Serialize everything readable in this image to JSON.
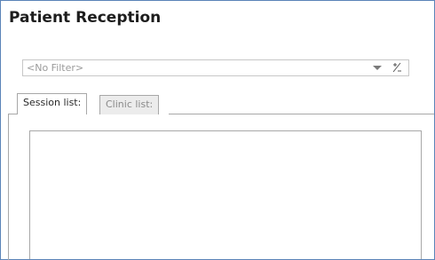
{
  "header": {
    "title": "Patient Reception"
  },
  "filter": {
    "value": "<No Filter>",
    "toggle_label": "+/-"
  },
  "tabs": [
    {
      "label": "Session list:",
      "selected": true
    },
    {
      "label": "Clinic list:",
      "selected": false
    }
  ],
  "colors": {
    "border_accent": "#5b84b8",
    "tab_border": "#a8a8a8",
    "inactive_tab_bg": "#ececec"
  },
  "icons": {
    "filter_dropdown": "chevron-down-icon",
    "filter_toggle": "plus-minus-icon"
  }
}
